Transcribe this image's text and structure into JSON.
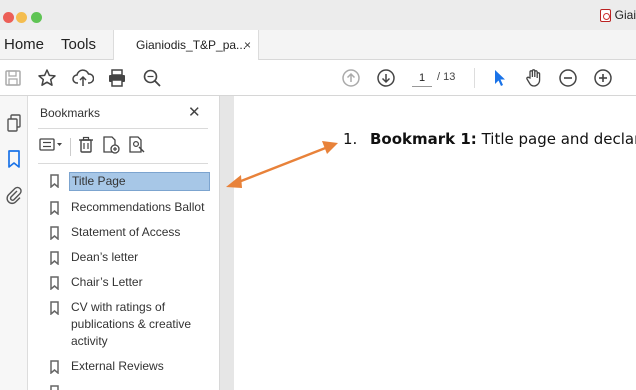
{
  "window": {
    "title": "Giai"
  },
  "nav": {
    "home": "Home",
    "tools": "Tools"
  },
  "tab": {
    "label": "Gianiodis_T&P_pa...",
    "close": "×"
  },
  "toolbar": {
    "current_page": "1",
    "total_pages": "/ 13"
  },
  "panel": {
    "title": "Bookmarks",
    "close": "✕",
    "items": [
      {
        "label": "Title Page",
        "selected": true
      },
      {
        "label": "Recommendations Ballot"
      },
      {
        "label": "Statement of Access"
      },
      {
        "label": "Dean’s letter"
      },
      {
        "label": "Chair’s Letter"
      },
      {
        "label": "CV with ratings of publications & creative activity"
      },
      {
        "label": "External Reviews"
      }
    ]
  },
  "document": {
    "number": "1.",
    "bold": "Bookmark 1:",
    "text": " Title page and declarat"
  },
  "colors": {
    "accent": "#1a73e8",
    "selection": "#a7c7e7",
    "annotation_arrow": "#e8823a"
  }
}
